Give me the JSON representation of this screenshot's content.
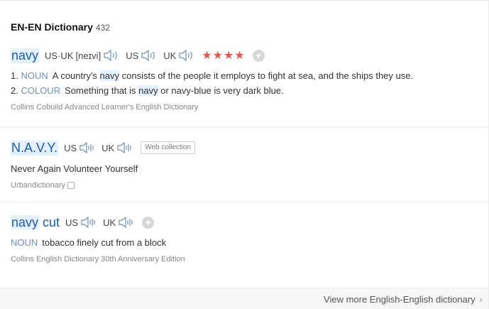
{
  "header": {
    "title": "EN-EN Dictionary",
    "count": "432"
  },
  "entries": [
    {
      "headword": "navy",
      "pron_label": "US·UK",
      "pron_text": "[neɪvi]",
      "us_label": "US",
      "uk_label": "UK",
      "stars": "★★★★",
      "senses": [
        {
          "num": "1.",
          "pos": "NOUN",
          "before": "A country's ",
          "hl": "navy",
          "after": " consists of the people it employs to fight at sea, and the ships they use."
        },
        {
          "num": "2.",
          "pos": "COLOUR",
          "before": "Something that is ",
          "hl": "navy",
          "after": " or navy-blue is very dark blue."
        }
      ],
      "source": "Collins Cobuild Advanced Learner's English Dictionary"
    },
    {
      "headword": "N.A.V.Y.",
      "us_label": "US",
      "uk_label": "UK",
      "badge": "Web collection",
      "definition": "Never Again Volunteer Yourself",
      "source": "Urbandictionary"
    },
    {
      "headword_hl": "navy",
      "headword_rest": " cut",
      "us_label": "US",
      "uk_label": "UK",
      "pos": "NOUN",
      "definition": "tobacco finely cut from a block",
      "source": "Collins English Dictionary 30th Anniversary Edition"
    }
  ],
  "footer": {
    "more": "View more English-English dictionary",
    "chevron": "›"
  },
  "icons": {
    "speaker": "speaker-icon",
    "plus": "plus-icon",
    "copy": "copy-icon",
    "star": "star-icon"
  },
  "colors": {
    "headword": "#1a5ea8",
    "highlight": "#e4efff",
    "stars": "#e05a4f",
    "pos": "#6f8fb5"
  }
}
